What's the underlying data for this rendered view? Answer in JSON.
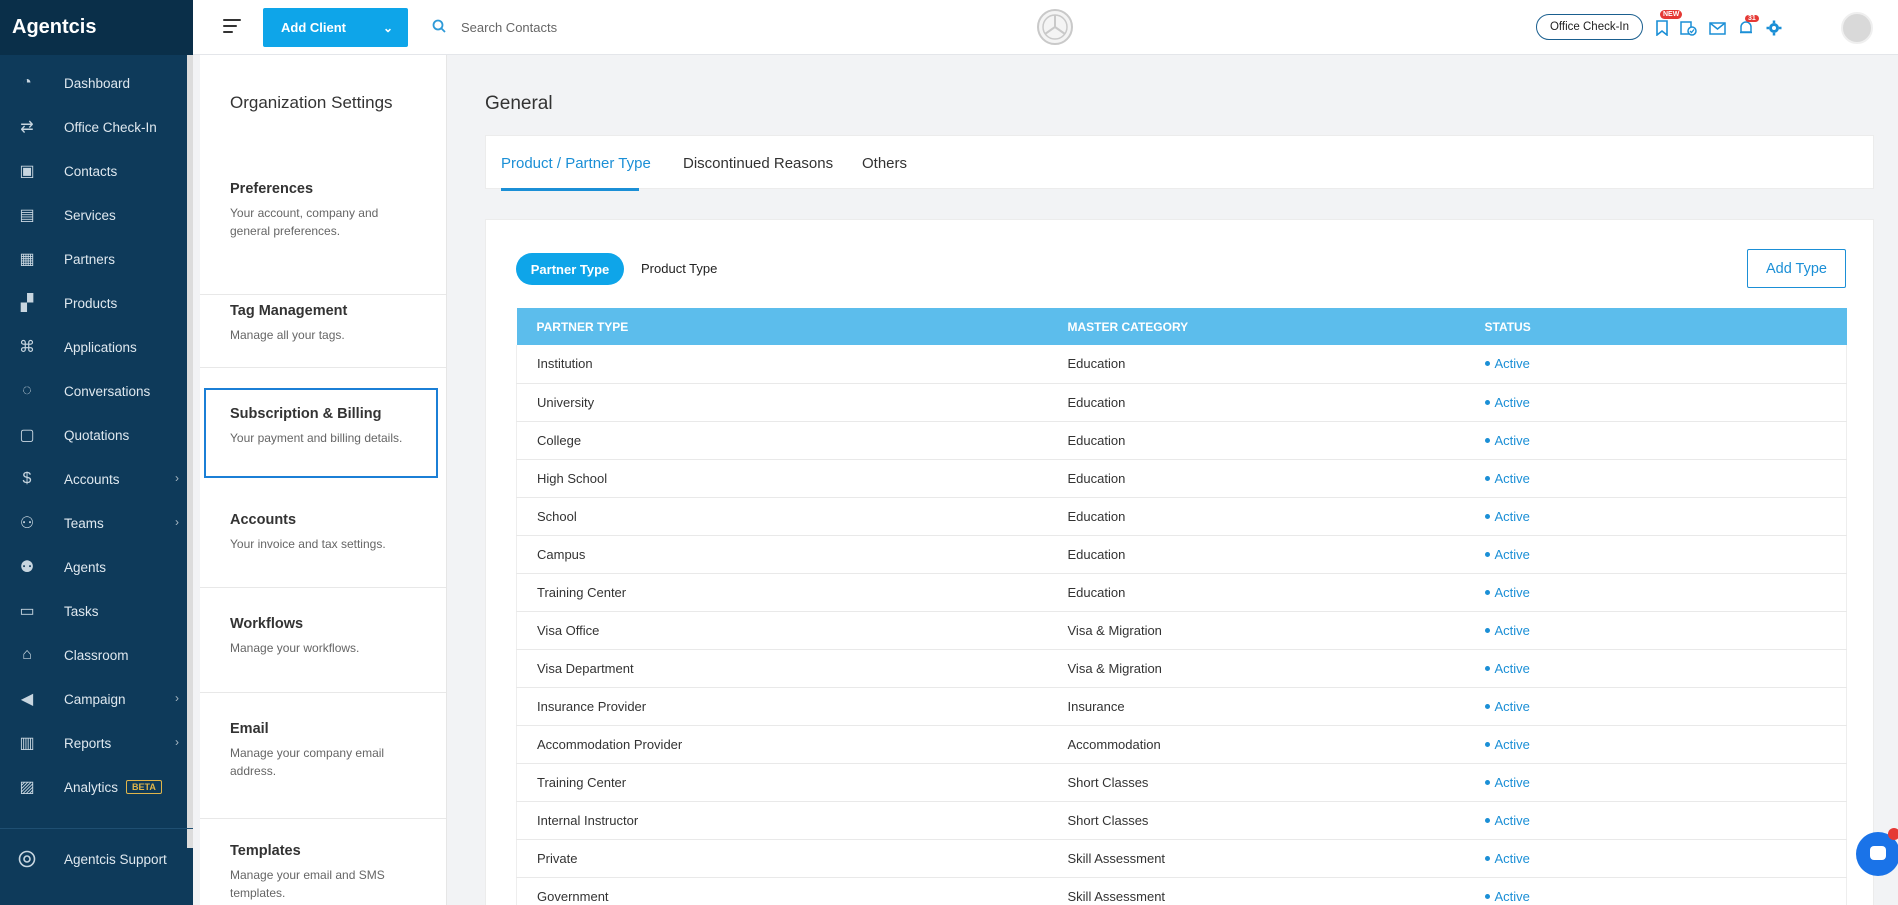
{
  "app": {
    "brand": "Agentcis"
  },
  "sidebar": {
    "items": [
      {
        "label": "Dashboard",
        "icon": "dashboard-icon",
        "chevron": false
      },
      {
        "label": "Office Check-In",
        "icon": "checkin-icon",
        "chevron": false
      },
      {
        "label": "Contacts",
        "icon": "contacts-icon",
        "chevron": false
      },
      {
        "label": "Services",
        "icon": "services-icon",
        "chevron": false
      },
      {
        "label": "Partners",
        "icon": "partners-icon",
        "chevron": false
      },
      {
        "label": "Products",
        "icon": "products-icon",
        "chevron": false
      },
      {
        "label": "Applications",
        "icon": "applications-icon",
        "chevron": false
      },
      {
        "label": "Conversations",
        "icon": "conversations-icon",
        "chevron": false
      },
      {
        "label": "Quotations",
        "icon": "quotations-icon",
        "chevron": false
      },
      {
        "label": "Accounts",
        "icon": "accounts-icon",
        "chevron": true
      },
      {
        "label": "Teams",
        "icon": "teams-icon",
        "chevron": true
      },
      {
        "label": "Agents",
        "icon": "agents-icon",
        "chevron": false
      },
      {
        "label": "Tasks",
        "icon": "tasks-icon",
        "chevron": false
      },
      {
        "label": "Classroom",
        "icon": "classroom-icon",
        "chevron": false
      },
      {
        "label": "Campaign",
        "icon": "campaign-icon",
        "chevron": true
      },
      {
        "label": "Reports",
        "icon": "reports-icon",
        "chevron": true
      },
      {
        "label": "Analytics",
        "icon": "analytics-icon",
        "chevron": false,
        "badge": "BETA"
      }
    ],
    "support": {
      "label": "Agentcis Support"
    }
  },
  "topbar": {
    "add_client_label": "Add Client",
    "search_placeholder": "Search Contacts",
    "checkin_label": "Office Check-In",
    "new_badge": "NEW",
    "notif_badge": "31"
  },
  "settings": {
    "title": "Organization Settings",
    "items": [
      {
        "title": "Preferences",
        "desc": "Your account, company and general preferences."
      },
      {
        "title": "Tag Management",
        "desc": "Manage all your tags."
      },
      {
        "title": "Subscription & Billing",
        "desc": "Your payment and billing details."
      },
      {
        "title": "Accounts",
        "desc": "Your invoice and tax settings."
      },
      {
        "title": "Workflows",
        "desc": "Manage your workflows."
      },
      {
        "title": "Email",
        "desc": "Manage your company email address."
      },
      {
        "title": "Templates",
        "desc": "Manage your email and SMS templates."
      }
    ]
  },
  "main": {
    "title": "General",
    "tabs": [
      {
        "label": "Product / Partner Type"
      },
      {
        "label": "Discontinued Reasons"
      },
      {
        "label": "Others"
      }
    ],
    "toggle": {
      "active": "Partner Type",
      "inactive": "Product Type"
    },
    "add_type_label": "Add Type",
    "table": {
      "headers": [
        "PARTNER TYPE",
        "MASTER CATEGORY",
        "STATUS"
      ],
      "rows": [
        [
          "Institution",
          "Education",
          "Active"
        ],
        [
          "University",
          "Education",
          "Active"
        ],
        [
          "College",
          "Education",
          "Active"
        ],
        [
          "High School",
          "Education",
          "Active"
        ],
        [
          "School",
          "Education",
          "Active"
        ],
        [
          "Campus",
          "Education",
          "Active"
        ],
        [
          "Training Center",
          "Education",
          "Active"
        ],
        [
          "Visa Office",
          "Visa & Migration",
          "Active"
        ],
        [
          "Visa Department",
          "Visa & Migration",
          "Active"
        ],
        [
          "Insurance Provider",
          "Insurance",
          "Active"
        ],
        [
          "Accommodation Provider",
          "Accommodation",
          "Active"
        ],
        [
          "Training Center",
          "Short Classes",
          "Active"
        ],
        [
          "Internal Instructor",
          "Short Classes",
          "Active"
        ],
        [
          "Private",
          "Skill Assessment",
          "Active"
        ],
        [
          "Government",
          "Skill Assessment",
          "Active"
        ]
      ]
    }
  },
  "colors": {
    "accent": "#0ea5e9",
    "sidebar": "#0e3a5a",
    "table_header": "#5cbdec",
    "link": "#1b8fd6"
  }
}
